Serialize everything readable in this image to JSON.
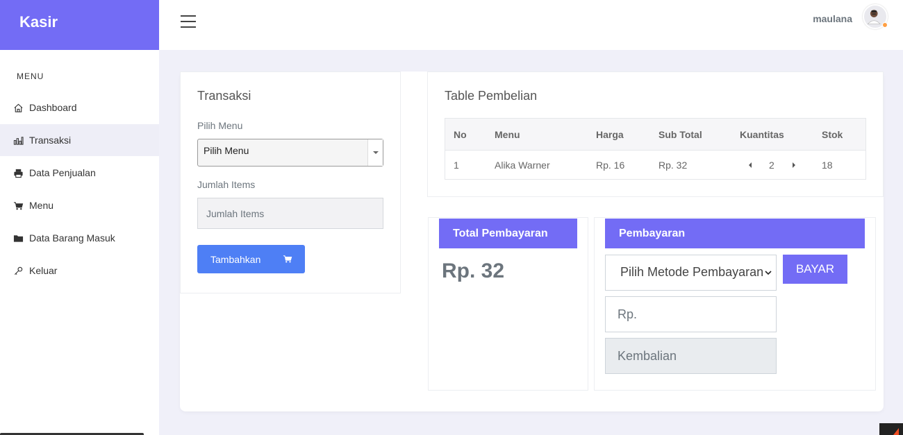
{
  "brand": "Kasir",
  "sidebar": {
    "heading": "MENU",
    "items": [
      {
        "label": "Dashboard",
        "icon": "home-icon"
      },
      {
        "label": "Transaksi",
        "icon": "bar-chart-icon"
      },
      {
        "label": "Data Penjualan",
        "icon": "printer-icon"
      },
      {
        "label": "Menu",
        "icon": "cart-icon"
      },
      {
        "label": "Data Barang Masuk",
        "icon": "folder-icon"
      },
      {
        "label": "Keluar",
        "icon": "key-icon"
      }
    ],
    "active_index": 1
  },
  "topbar": {
    "username": "maulana"
  },
  "transaksi": {
    "title": "Transaksi",
    "pilih_menu_label": "Pilih Menu",
    "pilih_menu_value": "Pilih Menu",
    "jumlah_label": "Jumlah Items",
    "jumlah_placeholder": "Jumlah Items",
    "add_button": "Tambahkan"
  },
  "table": {
    "title": "Table Pembelian",
    "columns": [
      "No",
      "Menu",
      "Harga",
      "Sub Total",
      "Kuantitas",
      "Stok"
    ],
    "rows": [
      {
        "no": "1",
        "menu": "Alika Warner",
        "harga": "Rp. 16",
        "sub_total": "Rp. 32",
        "kuantitas": "2",
        "stok": "18"
      }
    ]
  },
  "total": {
    "title": "Total Pembayaran",
    "value": "Rp. 32"
  },
  "pembayaran": {
    "title": "Pembayaran",
    "method_value": "Pilih Metode Pembayaran",
    "pay_button": "BAYAR",
    "amount_placeholder": "Rp.",
    "change_placeholder": "Kembalian"
  },
  "colors": {
    "accent": "#736cf5",
    "button_blue": "#4e7ff5",
    "background": "#f0f0f9"
  }
}
